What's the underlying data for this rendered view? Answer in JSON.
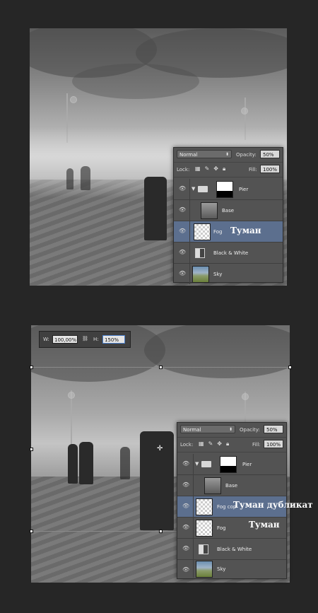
{
  "panel1": {
    "blend_mode": "Normal",
    "opacity_label": "Opacity:",
    "opacity_value": "50%",
    "lock_label": "Lock:",
    "fill_label": "Fill:",
    "fill_value": "100%",
    "layers": [
      {
        "name": "Pier",
        "type": "group",
        "selected": false
      },
      {
        "name": "Base",
        "type": "image",
        "selected": false
      },
      {
        "name": "Fog",
        "type": "transparent",
        "selected": true
      },
      {
        "name": "Black & White",
        "type": "adjustment",
        "selected": false
      },
      {
        "name": "Sky",
        "type": "sky",
        "selected": false
      }
    ],
    "annotation": "Туман"
  },
  "panel2": {
    "blend_mode": "Normal",
    "opacity_label": "Opacity:",
    "opacity_value": "50%",
    "lock_label": "Lock:",
    "fill_label": "Fill:",
    "fill_value": "100%",
    "layers": [
      {
        "name": "Pier",
        "type": "group",
        "selected": false
      },
      {
        "name": "Base",
        "type": "image",
        "selected": false
      },
      {
        "name": "Fog cop",
        "type": "transparent",
        "selected": true
      },
      {
        "name": "Fog",
        "type": "transparent",
        "selected": false
      },
      {
        "name": "Black & White",
        "type": "adjustment",
        "selected": false
      },
      {
        "name": "Sky",
        "type": "sky",
        "selected": false
      }
    ],
    "annotation_copy": "Туман дубликат",
    "annotation_fog": "Туман"
  },
  "options_bar": {
    "w_label": "W:",
    "w_value": "100,00%",
    "link_icon": "link-icon",
    "h_label": "H:",
    "h_value": "150%"
  }
}
